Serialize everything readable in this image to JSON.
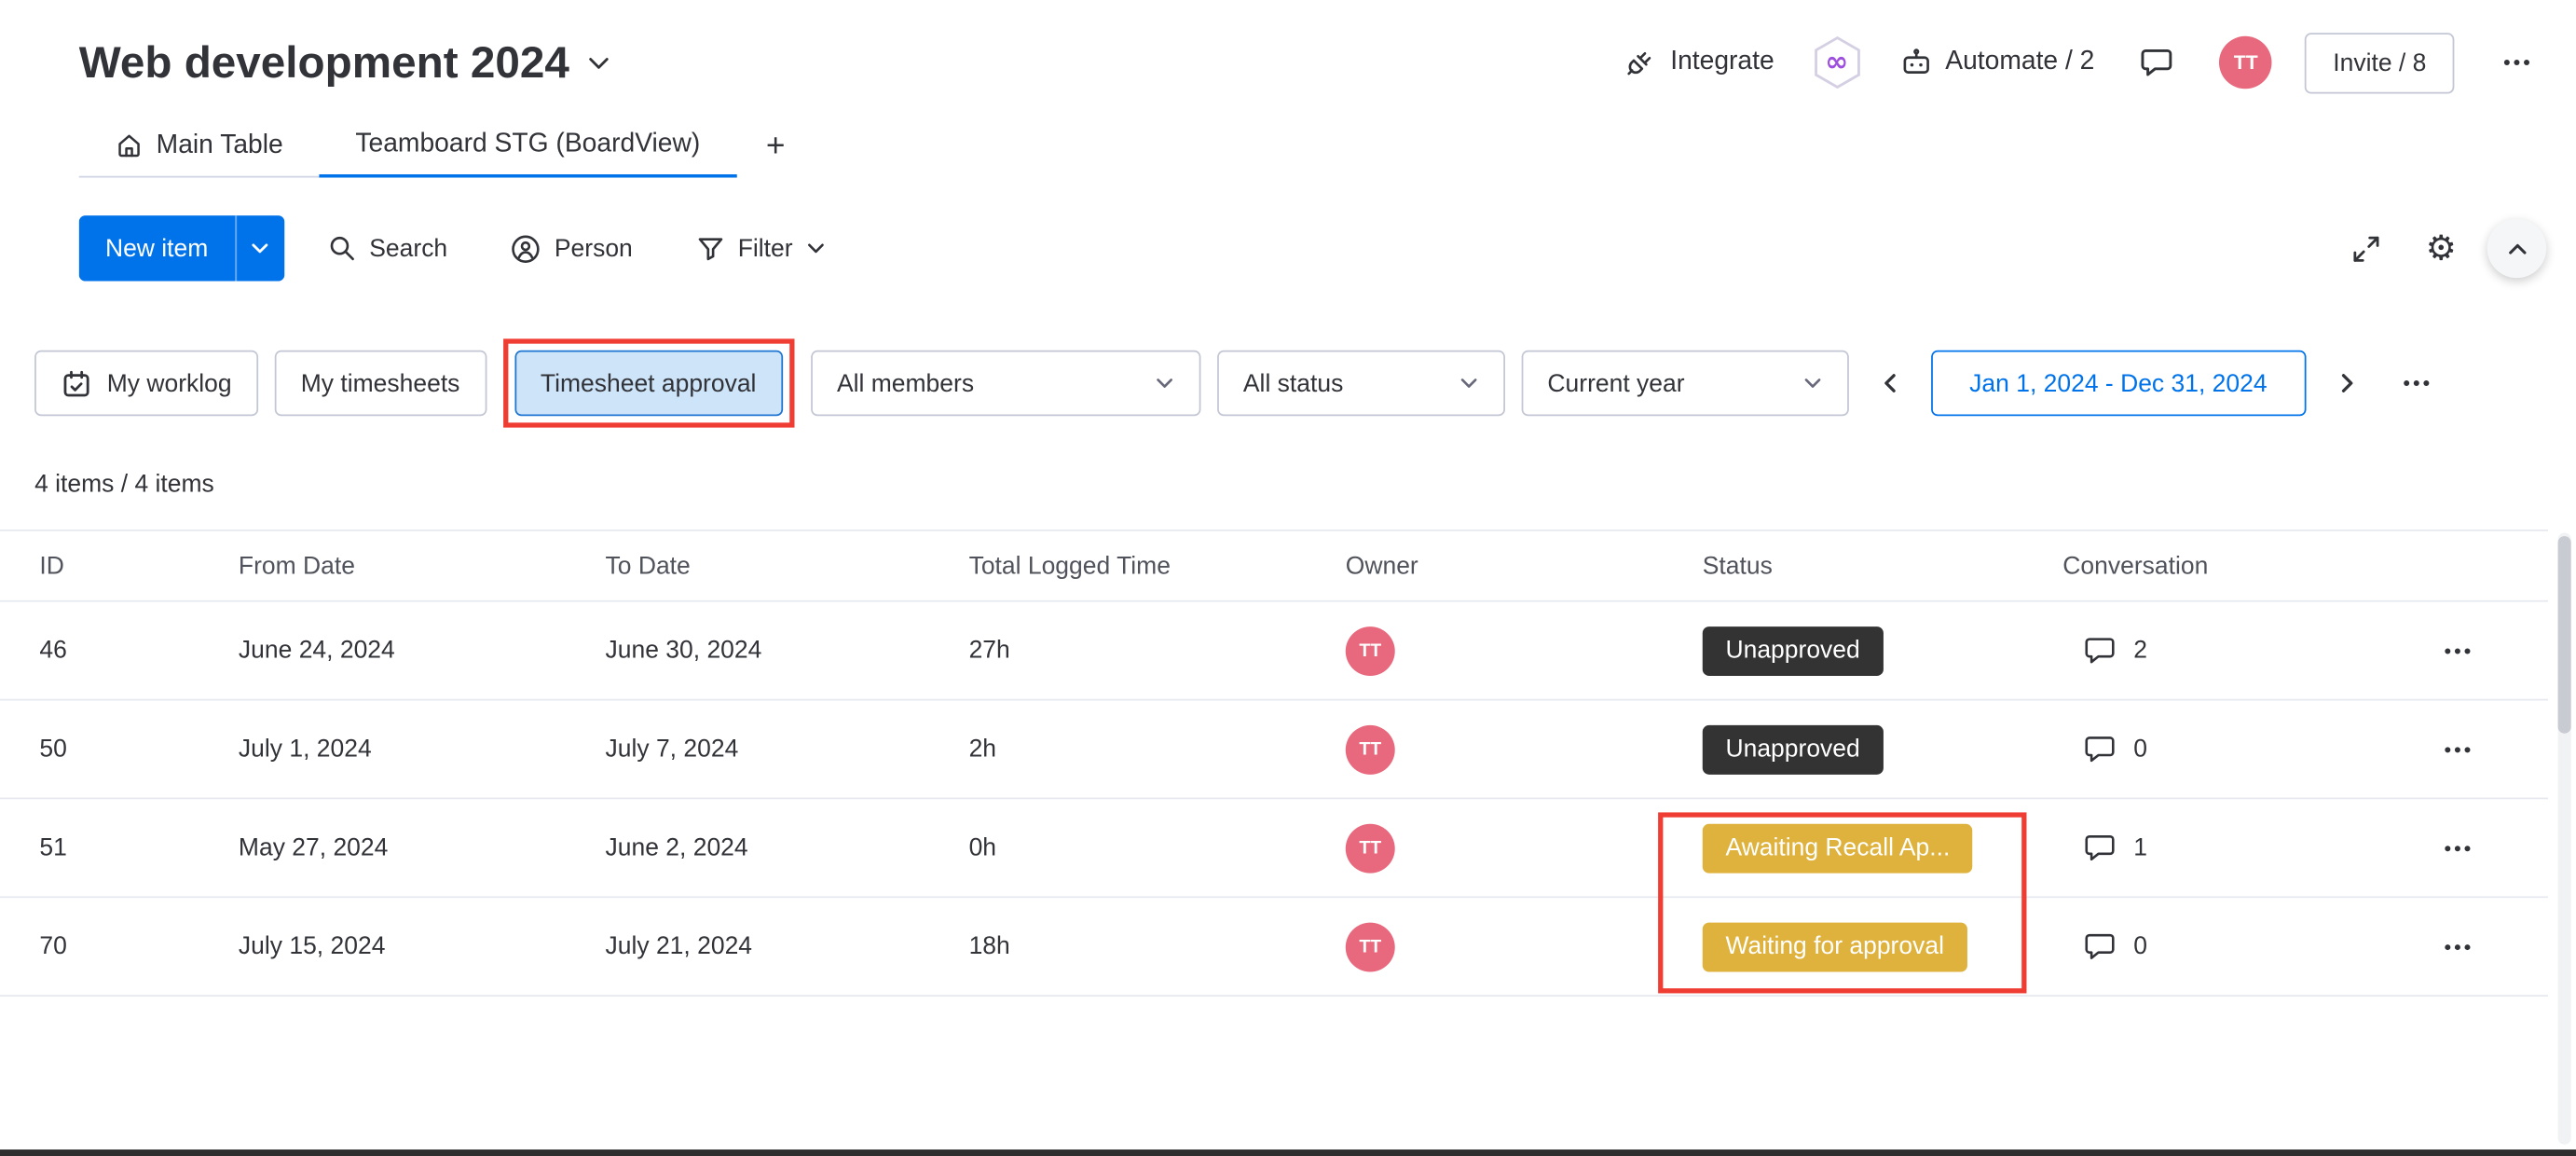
{
  "header": {
    "board_title": "Web development 2024",
    "integrate_label": "Integrate",
    "automate_label": "Automate / 2",
    "invite_label": "Invite / 8",
    "avatar_initials": "TT"
  },
  "icons": {
    "gear": "⚙",
    "infinity": "∞",
    "add_tab": "+"
  },
  "tabs": [
    {
      "label": "Main Table",
      "active": false
    },
    {
      "label": "Teamboard STG (BoardView)",
      "active": true
    }
  ],
  "toolbar": {
    "new_item_label": "New item",
    "search_label": "Search",
    "person_label": "Person",
    "filter_label": "Filter"
  },
  "filters": {
    "my_worklog": "My worklog",
    "my_timesheets": "My timesheets",
    "timesheet_approval": "Timesheet approval",
    "members_value": "All members",
    "status_value": "All status",
    "period_value": "Current year",
    "date_range": "Jan 1, 2024 - Dec 31, 2024"
  },
  "summary": "4 items / 4 items",
  "table": {
    "columns": [
      "ID",
      "From Date",
      "To Date",
      "Total Logged Time",
      "Owner",
      "Status",
      "Conversation"
    ],
    "rows": [
      {
        "id": "46",
        "from": "June 24, 2024",
        "to": "June 30, 2024",
        "time": "27h",
        "owner": "TT",
        "status": "Unapproved",
        "status_type": "dark",
        "conversation": "2"
      },
      {
        "id": "50",
        "from": "July 1, 2024",
        "to": "July 7, 2024",
        "time": "2h",
        "owner": "TT",
        "status": "Unapproved",
        "status_type": "dark",
        "conversation": "0"
      },
      {
        "id": "51",
        "from": "May 27, 2024",
        "to": "June 2, 2024",
        "time": "0h",
        "owner": "TT",
        "status": "Awaiting Recall Ap...",
        "status_type": "gold",
        "conversation": "1"
      },
      {
        "id": "70",
        "from": "July 15, 2024",
        "to": "July 21, 2024",
        "time": "18h",
        "owner": "TT",
        "status": "Waiting for approval",
        "status_type": "gold",
        "conversation": "0"
      }
    ]
  },
  "colors": {
    "accent_blue": "#0073ea",
    "status_dark": "#333333",
    "status_gold": "#deb23c",
    "avatar_pink": "#e8697d",
    "highlight_red": "#f03d33"
  }
}
